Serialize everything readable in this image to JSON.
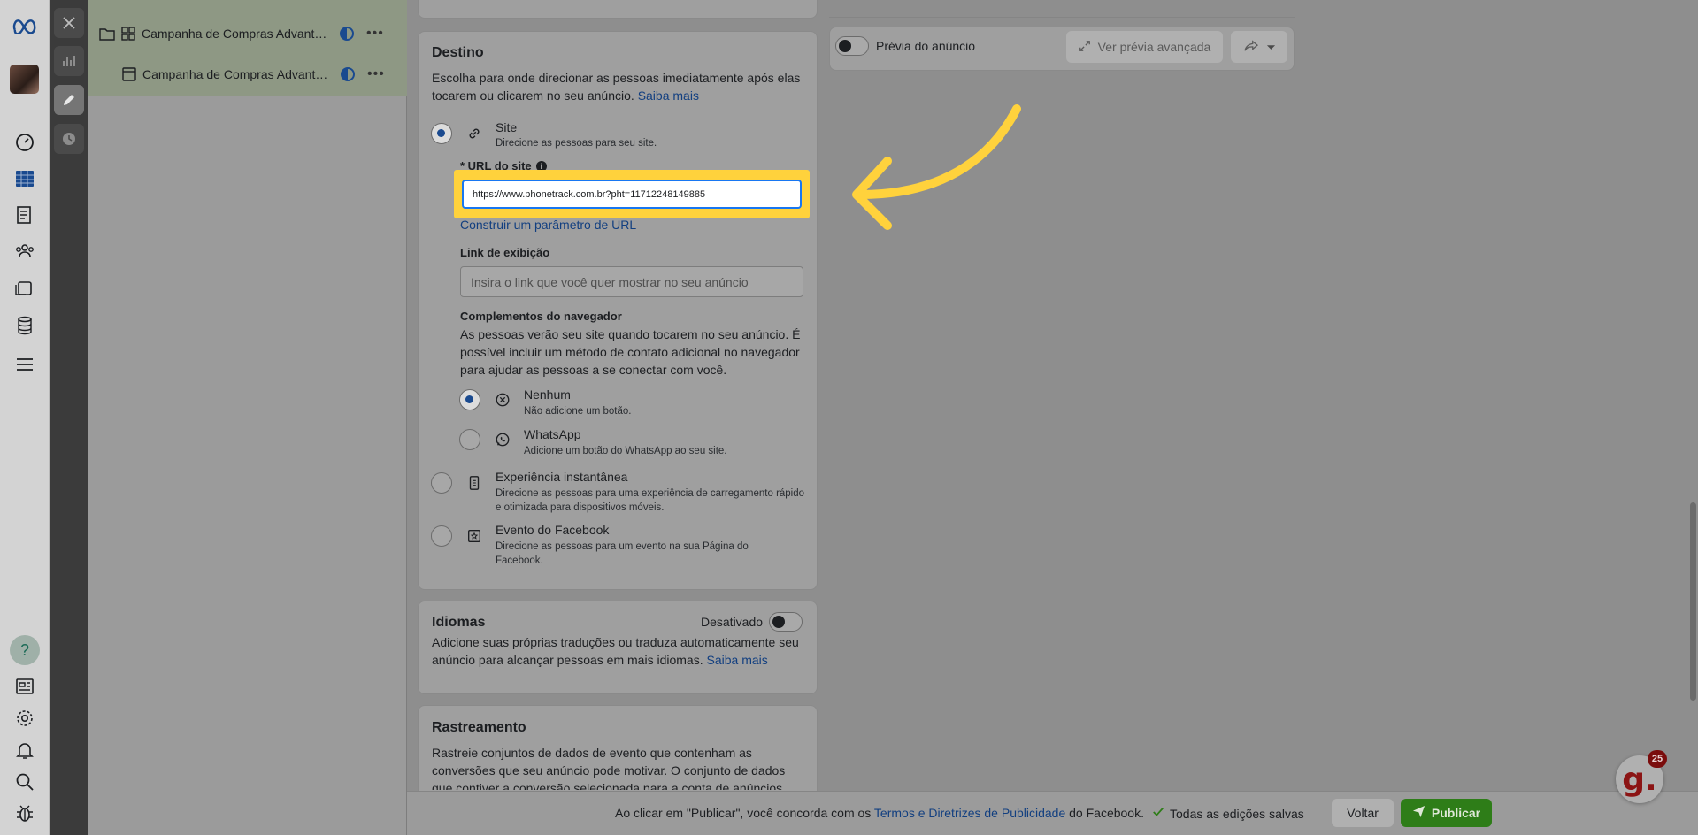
{
  "leftnav": {
    "icons": [
      "meta-logo-icon",
      "dashboard-icon",
      "ads-manager-table-icon",
      "pages-icon",
      "audiences-icon",
      "media-library-icon",
      "data-sources-icon",
      "menu-icon",
      "help-icon",
      "news-icon",
      "settings-icon",
      "notifications-icon",
      "search-icon",
      "bug-report-icon"
    ]
  },
  "tree": {
    "campaign_name": "Campanha de Compras Advantage+",
    "ad_name": "Campanha de Compras Advantage+"
  },
  "destino": {
    "title": "Destino",
    "description": "Escolha para onde direcionar as pessoas imediatamente após elas tocarem ou clicarem no seu anúncio.",
    "learn_more": "Saiba mais",
    "site_title": "Site",
    "site_desc": "Direcione as pessoas para seu site.",
    "url_label": "* URL do site",
    "url_value": "https://www.phonetrack.com.br?pht=11712248149885",
    "build_param_link": "Construir um parâmetro de URL",
    "display_link_label": "Link de exibição",
    "display_link_placeholder": "Insira o link que você quer mostrar no seu anúncio",
    "browser_addons_title": "Complementos do navegador",
    "browser_addons_desc": "As pessoas verão seu site quando tocarem no seu anúncio. É possível incluir um método de contato adicional no navegador para ajudar as pessoas a se conectar com você.",
    "none_title": "Nenhum",
    "none_desc": "Não adicione um botão.",
    "whatsapp_title": "WhatsApp",
    "whatsapp_desc": "Adicione um botão do WhatsApp ao seu site.",
    "instant_title": "Experiência instantânea",
    "instant_desc": "Direcione as pessoas para uma experiência de carregamento rápido e otimizada para dispositivos móveis.",
    "event_title": "Evento do Facebook",
    "event_desc": "Direcione as pessoas para um evento na sua Página do Facebook."
  },
  "idiomas": {
    "title": "Idiomas",
    "toggle_label": "Desativado",
    "description": "Adicione suas próprias traduções ou traduza automaticamente seu anúncio para alcançar pessoas em mais idiomas.",
    "learn_more": "Saiba mais"
  },
  "rastreamento": {
    "title": "Rastreamento",
    "description": "Rastreie conjuntos de dados de evento que contenham as conversões que seu anúncio pode motivar. O conjunto de dados que contiver a conversão selecionada para a conta de anúncios"
  },
  "preview": {
    "toggle_label": "Prévia do anúncio",
    "advanced_button": "Ver prévia avançada"
  },
  "footer": {
    "terms_prefix": "Ao clicar em \"Publicar\", você concorda com os",
    "terms_link": "Termos e Diretrizes de Publicidade",
    "terms_suffix": "do Facebook.",
    "saved_status": "Todas as edições salvas",
    "back_button": "Voltar",
    "publish_button": "Publicar"
  },
  "assistant": {
    "badge_count": "25",
    "logo_letter": "g."
  },
  "colors": {
    "highlight": "#ffd23c",
    "publish": "#2e7d18",
    "link": "#123f80",
    "accent": "#1877f2"
  }
}
